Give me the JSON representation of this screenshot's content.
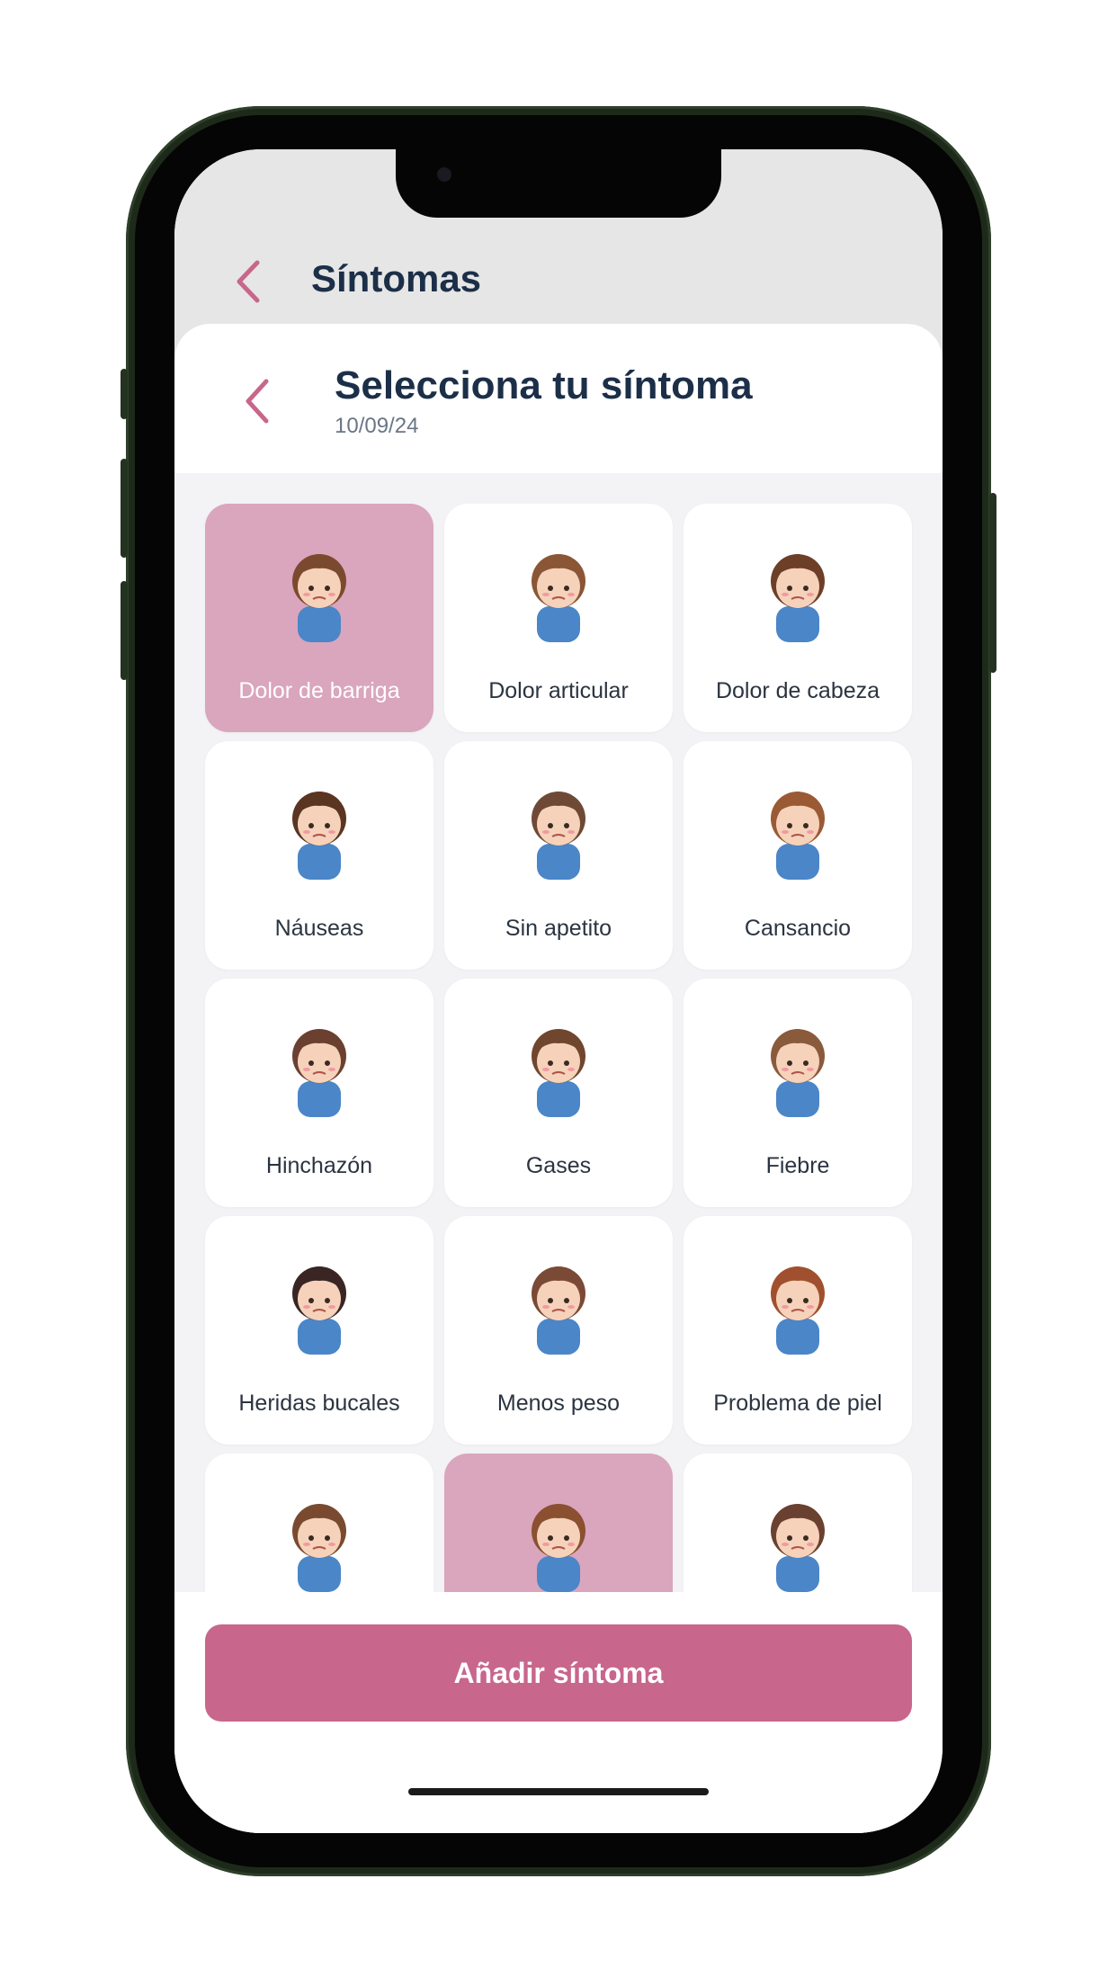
{
  "header": {
    "title": "Síntomas"
  },
  "sheet": {
    "title": "Selecciona tu síntoma",
    "date": "10/09/24"
  },
  "symptoms": [
    {
      "label": "Dolor de barriga",
      "selected": true,
      "icon": "girl-stomach-ache-icon"
    },
    {
      "label": "Dolor articular",
      "selected": false,
      "icon": "girl-joint-pain-icon"
    },
    {
      "label": "Dolor de cabeza",
      "selected": false,
      "icon": "girl-headache-icon"
    },
    {
      "label": "Náuseas",
      "selected": false,
      "icon": "boy-nausea-icon"
    },
    {
      "label": "Sin apetito",
      "selected": false,
      "icon": "boy-no-appetite-icon"
    },
    {
      "label": "Cansancio",
      "selected": false,
      "icon": "boy-tiredness-icon"
    },
    {
      "label": "Hinchazón",
      "selected": false,
      "icon": "boy-bloating-icon"
    },
    {
      "label": "Gases",
      "selected": false,
      "icon": "boy-gas-icon"
    },
    {
      "label": "Fiebre",
      "selected": false,
      "icon": "girl-fever-icon"
    },
    {
      "label": "Heridas bucales",
      "selected": false,
      "icon": "girl-mouth-sores-icon"
    },
    {
      "label": "Menos peso",
      "selected": false,
      "icon": "girl-weight-loss-icon"
    },
    {
      "label": "Problema de piel",
      "selected": false,
      "icon": "girl-skin-problem-icon"
    },
    {
      "label": "",
      "selected": false,
      "icon": "boy-chills-icon"
    },
    {
      "label": "",
      "selected": true,
      "icon": "boy-cramps-icon"
    },
    {
      "label": "",
      "selected": false,
      "icon": "boy-tingling-icon"
    }
  ],
  "actions": {
    "add_label": "Añadir síntoma"
  },
  "colors": {
    "accent": "#c8668b",
    "selected_card": "#d9a6bd",
    "title": "#1c2f48",
    "grid_bg": "#f3f3f6",
    "top_bg": "#e6e6e6"
  }
}
